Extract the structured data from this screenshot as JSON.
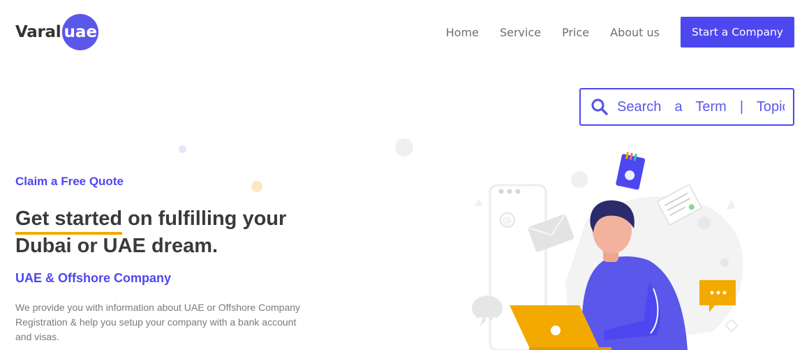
{
  "brand": {
    "name": "Varal",
    "badge": "uae",
    "accent": "#5a57ea"
  },
  "nav": {
    "items": [
      {
        "label": "Home"
      },
      {
        "label": "Service"
      },
      {
        "label": "Price"
      },
      {
        "label": "About us"
      }
    ],
    "cta_label": "Start a Company"
  },
  "search": {
    "placeholder": "Search  a  Term  |  Topic",
    "icon": "search-icon"
  },
  "hero": {
    "eyebrow": "Claim a Free Quote",
    "headline_highlight": "Get started",
    "headline_rest": " on fulfilling your Dubai or UAE dream.",
    "subhead": "UAE & Offshore Company",
    "description": "We provide you with information about UAE or Offshore Company Registration & help you setup your company with a bank account and visas."
  },
  "colors": {
    "primary": "#4d47f0",
    "highlight": "#f2a900",
    "text": "#3a3a3a",
    "muted": "#7a7a7a"
  }
}
